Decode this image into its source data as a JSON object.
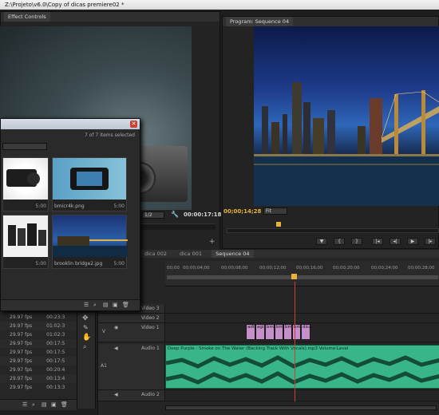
{
  "window": {
    "title": "Z:\\Projeto\\v6.0\\Copy of dicas premiere02 *"
  },
  "source_panel": {
    "tab": "Effect Controls",
    "timecode": "00:00:17:18",
    "scale": "1/2"
  },
  "program_panel": {
    "tab": "Program: Sequence 04",
    "timecode": "00;00;14;28",
    "fit": "Fit"
  },
  "media_browser": {
    "selection_count": "7 of 7 items selected",
    "items": [
      {
        "name": "",
        "duration": "5:00"
      },
      {
        "name": "bmicr4k.png",
        "duration": "5:00"
      },
      {
        "name": "",
        "duration": "5:00"
      },
      {
        "name": "brooklin bridge2.jpg",
        "duration": "5:00"
      }
    ]
  },
  "project_list": {
    "rows": [
      {
        "fps": "29.97 fps",
        "time": "00:23:3"
      },
      {
        "fps": "29.97 fps",
        "time": "01:02:3"
      },
      {
        "fps": "29.97 fps",
        "time": "01:02:3"
      },
      {
        "fps": "29.97 fps",
        "time": "00:17:5"
      },
      {
        "fps": "29.97 fps",
        "time": "00:17:5"
      },
      {
        "fps": "29.97 fps",
        "time": "00:17:5"
      },
      {
        "fps": "29.97 fps",
        "time": "00:20:4"
      },
      {
        "fps": "29.97 fps",
        "time": "00:13:4"
      },
      {
        "fps": "29.97 fps",
        "time": "00:13:3"
      }
    ]
  },
  "timeline": {
    "tabs": [
      "dica 002",
      "dica 001",
      "Sequence 04"
    ],
    "ruler": [
      "00;00",
      "00;00;04;00",
      "00;00;08;00",
      "00;00;12;00",
      "00;00;16;00",
      "00;00;20;00",
      "00;00;24;00",
      "00;00;28;00"
    ],
    "tracks": {
      "video3": "Video 3",
      "video2": "Video 2",
      "video1": "Video 1",
      "audio1": "Audio 1",
      "audio2": "Audio 2",
      "v_label": "V",
      "a_label": "A1"
    },
    "video_clips": [
      "adt",
      "agi",
      "bmi",
      "bm",
      "bm",
      "bric",
      "dica"
    ],
    "audio_clip": "Deep Purple - Smoke on The Water (Backing Track With Vocals).mp3  Volume:Level"
  },
  "colors": {
    "accent_timecode": "#e8b23a",
    "video_clip": "#c58fc9",
    "audio_clip": "#39b58a",
    "playhead": "#d23a3a"
  }
}
